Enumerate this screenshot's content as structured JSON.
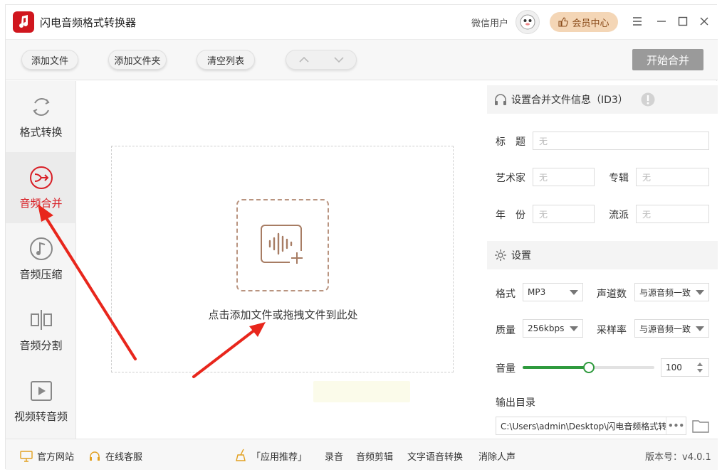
{
  "app": {
    "title": "闪电音频格式转换器"
  },
  "header": {
    "user_name": "微信用户",
    "vip_label": "会员中心"
  },
  "toolbar": {
    "add_file": "添加文件",
    "add_folder": "添加文件夹",
    "clear_list": "清空列表",
    "start_merge": "开始合并"
  },
  "sidebar": {
    "items": [
      {
        "label": "格式转换",
        "icon": "refresh-icon",
        "active": false
      },
      {
        "label": "音频合并",
        "icon": "merge-icon",
        "active": true
      },
      {
        "label": "音频压缩",
        "icon": "music-note-icon",
        "active": false
      },
      {
        "label": "音频分割",
        "icon": "split-icon",
        "active": false
      },
      {
        "label": "视频转音频",
        "icon": "video-play-icon",
        "active": false
      }
    ]
  },
  "dropzone": {
    "text": "点击添加文件或拖拽文件到此处"
  },
  "id3": {
    "header": "设置合并文件信息（ID3）",
    "title_label": "标　题",
    "title_placeholder": "无",
    "artist_label": "艺术家",
    "artist_placeholder": "无",
    "album_label": "专辑",
    "album_placeholder": "无",
    "year_label": "年　份",
    "year_placeholder": "无",
    "genre_label": "流派",
    "genre_placeholder": "无"
  },
  "settings": {
    "header": "设置",
    "format_label": "格式",
    "format_value": "MP3",
    "channels_label": "声道数",
    "channels_value": "与源音频一致",
    "quality_label": "质量",
    "quality_value": "256kbps",
    "samplerate_label": "采样率",
    "samplerate_value": "与源音频一致",
    "volume_label": "音量",
    "volume_value": "100",
    "volume_fraction": 0.5,
    "output_label": "输出目录",
    "output_path": "C:\\Users\\admin\\Desktop\\闪电音频格式转换器"
  },
  "footer": {
    "website": "官方网站",
    "support": "在线客服",
    "recommend": "「应用推荐」",
    "record": "录音",
    "audio_edit": "音频剪辑",
    "tts": "文字语音转换",
    "vocal_remove": "消除人声",
    "version": "版本号：v4.0.1"
  },
  "colors": {
    "brand_red": "#d0161e",
    "active_red": "#d81f26",
    "slider_green": "#2e9a3d",
    "vip_bg": "#f4d6b6",
    "annotation_red": "#e8261c"
  }
}
